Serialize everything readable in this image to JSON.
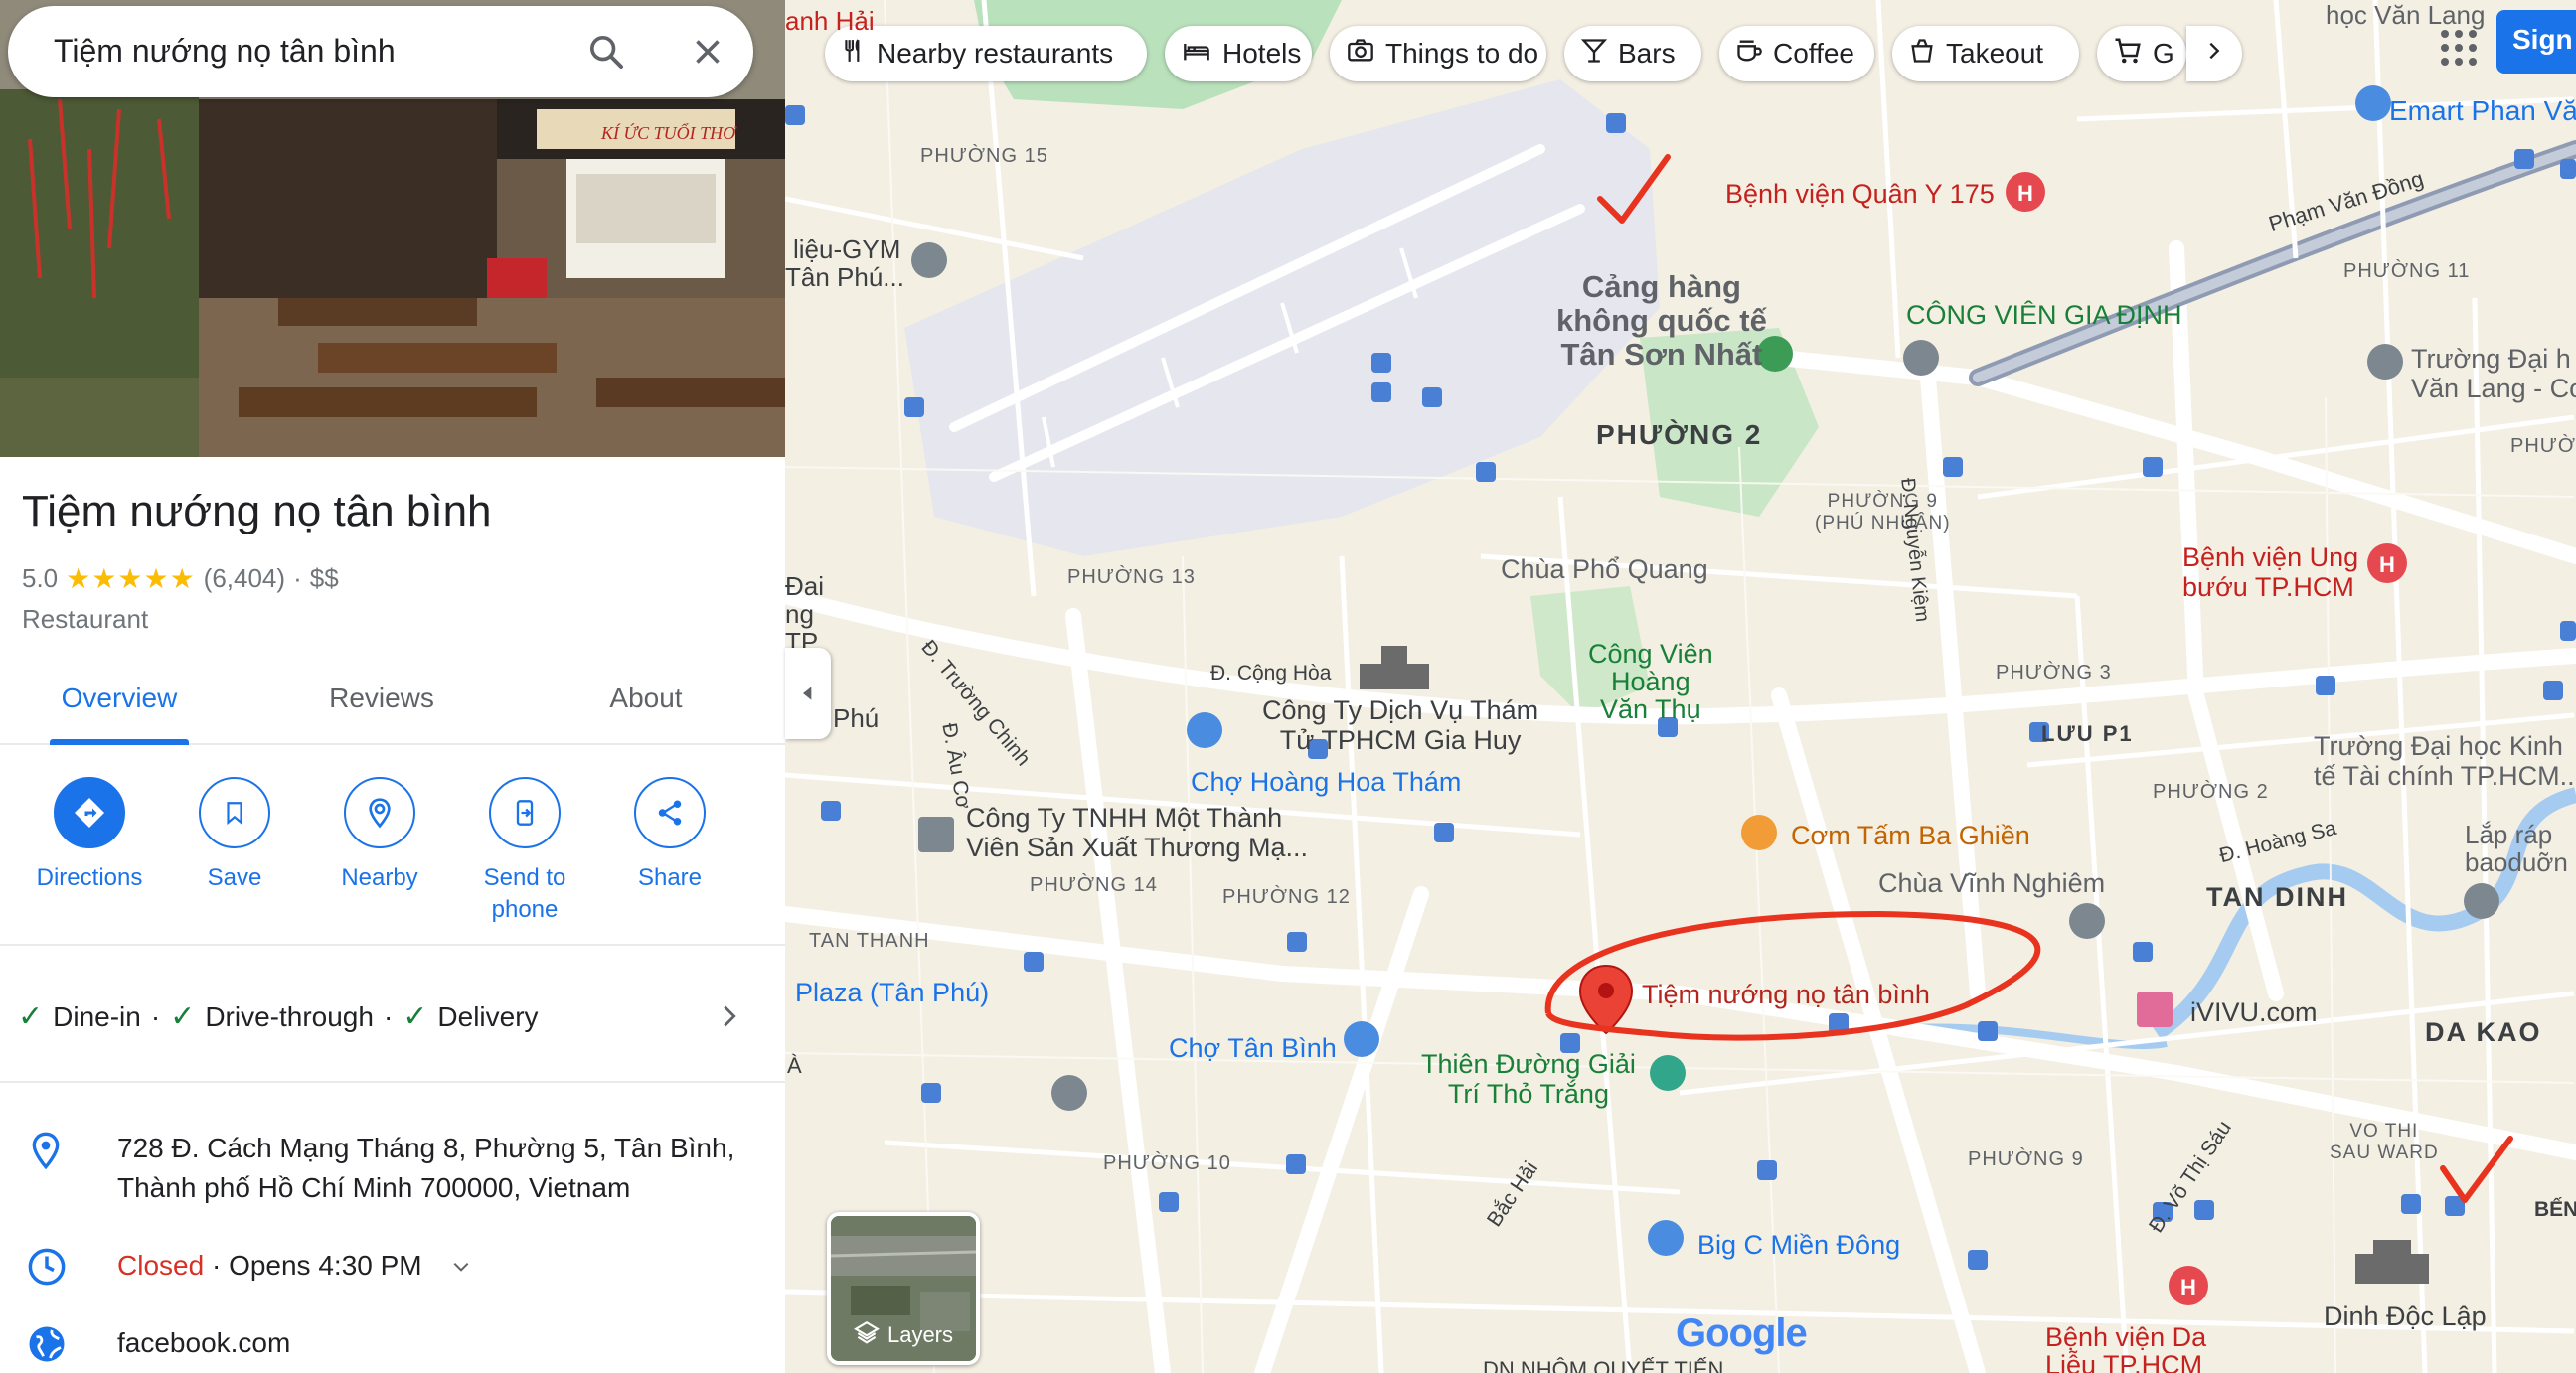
{
  "search": {
    "value": "Tiệm nướng nọ tân bình",
    "search_icon": "search-icon",
    "clear_icon": "close-icon"
  },
  "hero": {
    "sign_text": "KÍ ỨC TUỔI THƠ"
  },
  "place": {
    "name": "Tiệm nướng nọ tân bình",
    "rating": "5.0",
    "stars": "★★★★★",
    "review_count": "(6,404)",
    "separator": "·",
    "price": "$$",
    "category": "Restaurant"
  },
  "tabs": [
    {
      "label": "Overview",
      "active": true
    },
    {
      "label": "Reviews",
      "active": false
    },
    {
      "label": "About",
      "active": false
    }
  ],
  "actions": [
    {
      "label": "Directions",
      "icon": "directions-icon"
    },
    {
      "label": "Save",
      "icon": "bookmark-icon"
    },
    {
      "label": "Nearby",
      "icon": "nearby-icon"
    },
    {
      "label": "Send to phone",
      "icon": "send-to-phone-icon"
    },
    {
      "label": "Share",
      "icon": "share-icon"
    }
  ],
  "services": {
    "items": [
      "Dine-in",
      "Drive-through",
      "Delivery"
    ],
    "separator": "·"
  },
  "info": {
    "address_line1": "728 Đ. Cách Mạng Tháng 8, Phường 5, Tân Bình,",
    "address_line2": "Thành phố Hồ Chí Minh 700000, Vietnam",
    "hours_status": "Closed",
    "hours_separator": "·",
    "hours_next": "Opens 4:30 PM",
    "website": "facebook.com"
  },
  "chips": [
    {
      "label": "Nearby restaurants",
      "icon": "fork-knife-icon"
    },
    {
      "label": "Hotels",
      "icon": "bed-icon"
    },
    {
      "label": "Things to do",
      "icon": "camera-icon"
    },
    {
      "label": "Bars",
      "icon": "cocktail-icon"
    },
    {
      "label": "Coffee",
      "icon": "coffee-icon"
    },
    {
      "label": "Takeout",
      "icon": "takeout-icon"
    },
    {
      "label": "G",
      "icon": "cart-icon"
    }
  ],
  "map": {
    "labels": {
      "top_left_1": "anh Hải",
      "top_right_school": "học Văn Lang",
      "emart": "Emart Phan Vă",
      "phuong15": "PHƯỜNG 15",
      "hospital175": "Bệnh viện Quân Y 175",
      "pham_van_dong": "Phạm Văn Đồng",
      "phuong11": "PHƯỜNG 11",
      "gym": "liệu-GYM",
      "tan_phu_top": "Tân Phú...",
      "airport1": "Cảng hàng",
      "airport2": "không quốc tế",
      "airport3": "Tân Sơn Nhất",
      "cong_vien_gia_dinh": "CÔNG VIÊN GIA ĐỊNH",
      "van_lang1": "Trường Đại h",
      "van_lang2": "Văn Lang - Cơ",
      "phuong2_big": "PHƯỜNG 2",
      "phuong9_pn1": "PHƯỜNG 9",
      "phuong9_pn2": "(PHÚ NHUẬN)",
      "nguyen_kiem": "Đ. Nguyễn Kiệm",
      "phuong_right": "PHƯỜNG",
      "phuong13": "PHƯỜNG 13",
      "chua_pho_quang": "Chùa Phổ Quang",
      "ung_buou1": "Bệnh viện Ung",
      "ung_buou2": "bướu TP.HCM",
      "dai": "Đai",
      "ng": "ng",
      "tp": "TP",
      "truong_chinh": "Đ. Trường Chinh",
      "cong_hoa": "Đ. Cộng Hòa",
      "gia_huy1": "Công Ty Dịch Vụ Thám",
      "gia_huy2": "Tử TPHCM Gia Huy",
      "cv_hvt1": "Công Viên",
      "cv_hvt2": "Hoàng",
      "cv_hvt3": "Văn Thụ",
      "phuong3": "PHƯỜNG 3",
      "luu_p1": "LƯU P1",
      "phu": "Phú",
      "au_co": "Đ. Âu Cơ",
      "cho_hoang_hoa_tham": "Chợ Hoàng Hoa Thám",
      "kinh_te1": "Trường Đại học Kinh",
      "kinh_te2": "tế Tài chính TP.HCM...",
      "tnhh1": "Công Ty TNHH Một Thành",
      "tnhh2": "Viên Sản Xuất Thương Mạ...",
      "com_tam": "Cơm Tấm Ba Ghiền",
      "phuong2_right": "PHƯỜNG 2",
      "hoang_sa": "Đ. Hoàng Sa",
      "lap_rap1": "Lắp ráp",
      "lap_rap2": "baoduỡn",
      "phuong14": "PHƯỜNG 14",
      "phuong12": "PHƯỜNG 12",
      "chua_vinh_nghiem": "Chùa Vĩnh Nghiêm",
      "tan_dinh": "TAN DINH",
      "tan_thanh": "TAN THANH",
      "plaza": "Plaza (Tân Phú)",
      "selected_place": "Tiệm nướng nọ tân bình",
      "ivivu": "iVIVU.com",
      "da_kao": "DA KAO",
      "a": "À",
      "cho_tan_binh": "Chợ Tân Bình",
      "thien_duong1": "Thiên Đường Giải",
      "thien_duong2": "Trí Thỏ Trắng",
      "vo_thi_sau_ward1": "VO THI",
      "vo_thi_sau_ward2": "SAU WARD",
      "phuong10": "PHƯỜNG 10",
      "phuong9": "PHƯỜNG 9",
      "vo_thi_sau": "Đ. Võ Thị Sáu",
      "bac_hai": "Bắc Hải",
      "ben": "BẾN",
      "big_c": "Big C Miền Đông",
      "dinh_doc_lap": "Dinh Độc Lập",
      "benh_vien_da1": "Bệnh viện Da",
      "benh_vien_da2": "Liễu TP.HCM",
      "dn_nhom": "DN NHÔM QUYẾT TIẾN"
    },
    "layers_label": "Layers",
    "signin_label": "Sign",
    "google_logo": "Google",
    "colors": {
      "accent": "#1a73e8",
      "annotation": "#e8331f",
      "pin": "#ea4335"
    }
  }
}
